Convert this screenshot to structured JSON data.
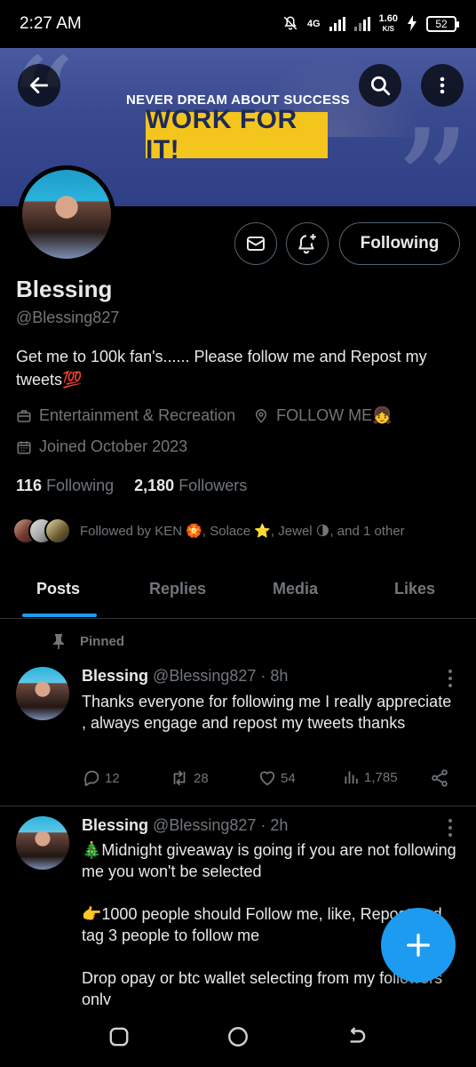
{
  "status_bar": {
    "time": "2:27 AM",
    "network": "4G",
    "speed_value": "1.60",
    "speed_unit": "K/S",
    "battery": "52"
  },
  "banner": {
    "tagline": "NEVER DREAM ABOUT SUCCESS",
    "cta": "WORK FOR IT!",
    "cta_color": "#f4c51d"
  },
  "profile": {
    "name": "Blessing",
    "handle": "@Blessing827",
    "bio": "Get me to 100k fan's...... Please follow me and Repost my tweets💯",
    "category": "Entertainment & Recreation",
    "location": "FOLLOW ME👧",
    "joined": "Joined October 2023",
    "following_count": "116",
    "following_label": "Following",
    "followers_count": "2,180",
    "followers_label": "Followers",
    "followed_by": "Followed by KEN 🏵️, Solace ⭐, Jewel 🌗, and 1 other",
    "follow_button": "Following"
  },
  "tabs": [
    "Posts",
    "Replies",
    "Media",
    "Likes"
  ],
  "active_tab": "Posts",
  "accent_color": "#1d9bf0",
  "pinned_label": "Pinned",
  "tweets": [
    {
      "name": "Blessing",
      "handle": "@Blessing827",
      "time": "· 8h",
      "text": "Thanks everyone for following me I really appreciate , always engage and repost my tweets thanks",
      "replies": "12",
      "reposts": "28",
      "likes": "54",
      "views": "1,785"
    },
    {
      "name": "Blessing",
      "handle": "@Blessing827",
      "time": "· 2h",
      "line1": "🎄Midnight giveaway is going if you are not following me you won't be selected",
      "line2": "👉1000 people should Follow me, like, Repost and tag 3 people to follow me",
      "line3": "Drop opay or btc wallet selecting from my followers only"
    }
  ],
  "icons": {
    "back": "arrow-left-icon",
    "search": "search-icon",
    "more": "more-vertical-icon",
    "message": "mail-icon",
    "notify": "bell-plus-icon",
    "compose": "plus-icon"
  }
}
